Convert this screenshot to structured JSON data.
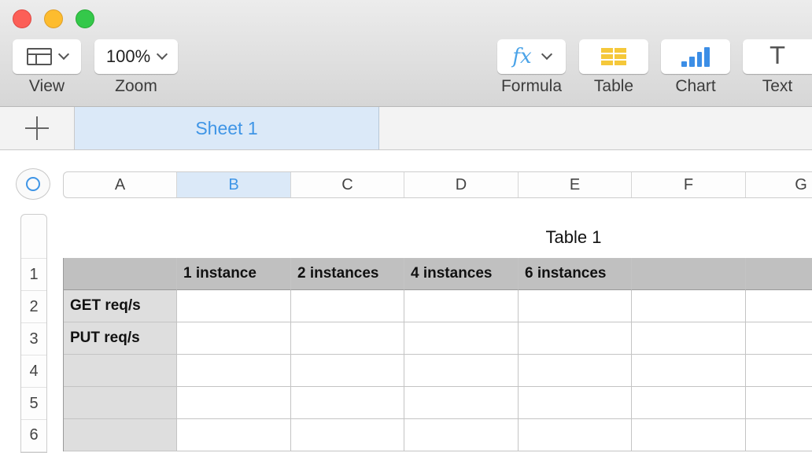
{
  "window": {
    "traffic_lights": [
      "close",
      "minimize",
      "zoom"
    ]
  },
  "toolbar": {
    "view_label": "View",
    "zoom_value": "100%",
    "zoom_label": "Zoom",
    "formula_icon_text": "fx",
    "formula_label": "Formula",
    "table_label": "Table",
    "chart_label": "Chart",
    "text_icon_glyph": "T",
    "text_label": "Text"
  },
  "sheets": {
    "tabs": [
      "Sheet 1"
    ],
    "active": "Sheet 1"
  },
  "spreadsheet": {
    "column_headers": [
      "A",
      "B",
      "C",
      "D",
      "E",
      "F",
      "G"
    ],
    "selected_column": "B",
    "row_headers": [
      "1",
      "2",
      "3",
      "4",
      "5",
      "6"
    ],
    "table_title": "Table 1",
    "header_row": [
      "",
      "1 instance",
      "2 instances",
      "4 instances",
      "6 instances",
      "",
      ""
    ],
    "rows": [
      [
        "GET req/s",
        "",
        "",
        "",
        "",
        "",
        ""
      ],
      [
        "PUT req/s",
        "",
        "",
        "",
        "",
        "",
        ""
      ],
      [
        "",
        "",
        "",
        "",
        "",
        "",
        ""
      ],
      [
        "",
        "",
        "",
        "",
        "",
        "",
        ""
      ],
      [
        "",
        "",
        "",
        "",
        "",
        "",
        ""
      ]
    ]
  },
  "colors": {
    "accent": "#3f95e6",
    "selection_fill": "#dbe9f8",
    "header_row_fill": "#c0c0c0",
    "row_header_fill": "#dedede"
  }
}
